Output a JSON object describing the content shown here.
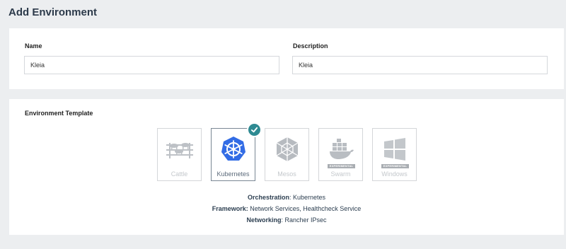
{
  "page": {
    "title": "Add Environment"
  },
  "form": {
    "name_label": "Name",
    "name_value": "Kleia",
    "description_label": "Description",
    "description_value": "Kleia"
  },
  "template_section": {
    "label": "Environment Template",
    "templates": [
      {
        "label": "Cattle",
        "icon": "cattle-icon",
        "selected": false,
        "experimental": false
      },
      {
        "label": "Kubernetes",
        "icon": "kubernetes-helm-icon",
        "selected": true,
        "experimental": false
      },
      {
        "label": "Mesos",
        "icon": "mesos-icon",
        "selected": false,
        "experimental": false
      },
      {
        "label": "Swarm",
        "icon": "swarm-whale-icon",
        "selected": false,
        "experimental": true
      },
      {
        "label": "Windows",
        "icon": "windows-icon",
        "selected": false,
        "experimental": true
      }
    ],
    "experimental_badge": "EXPERIMENTAL",
    "orchestration_label": "Orchestration",
    "orchestration_value": ": Kubernetes",
    "framework_label": "Framework:",
    "framework_value": " Network Services, Healthcheck Service",
    "networking_label": "Networking",
    "networking_value": ": Rancher IPsec"
  },
  "colors": {
    "accent": "#2e8a92",
    "kubernetes_blue": "#326ce5",
    "background": "#eceef0"
  }
}
